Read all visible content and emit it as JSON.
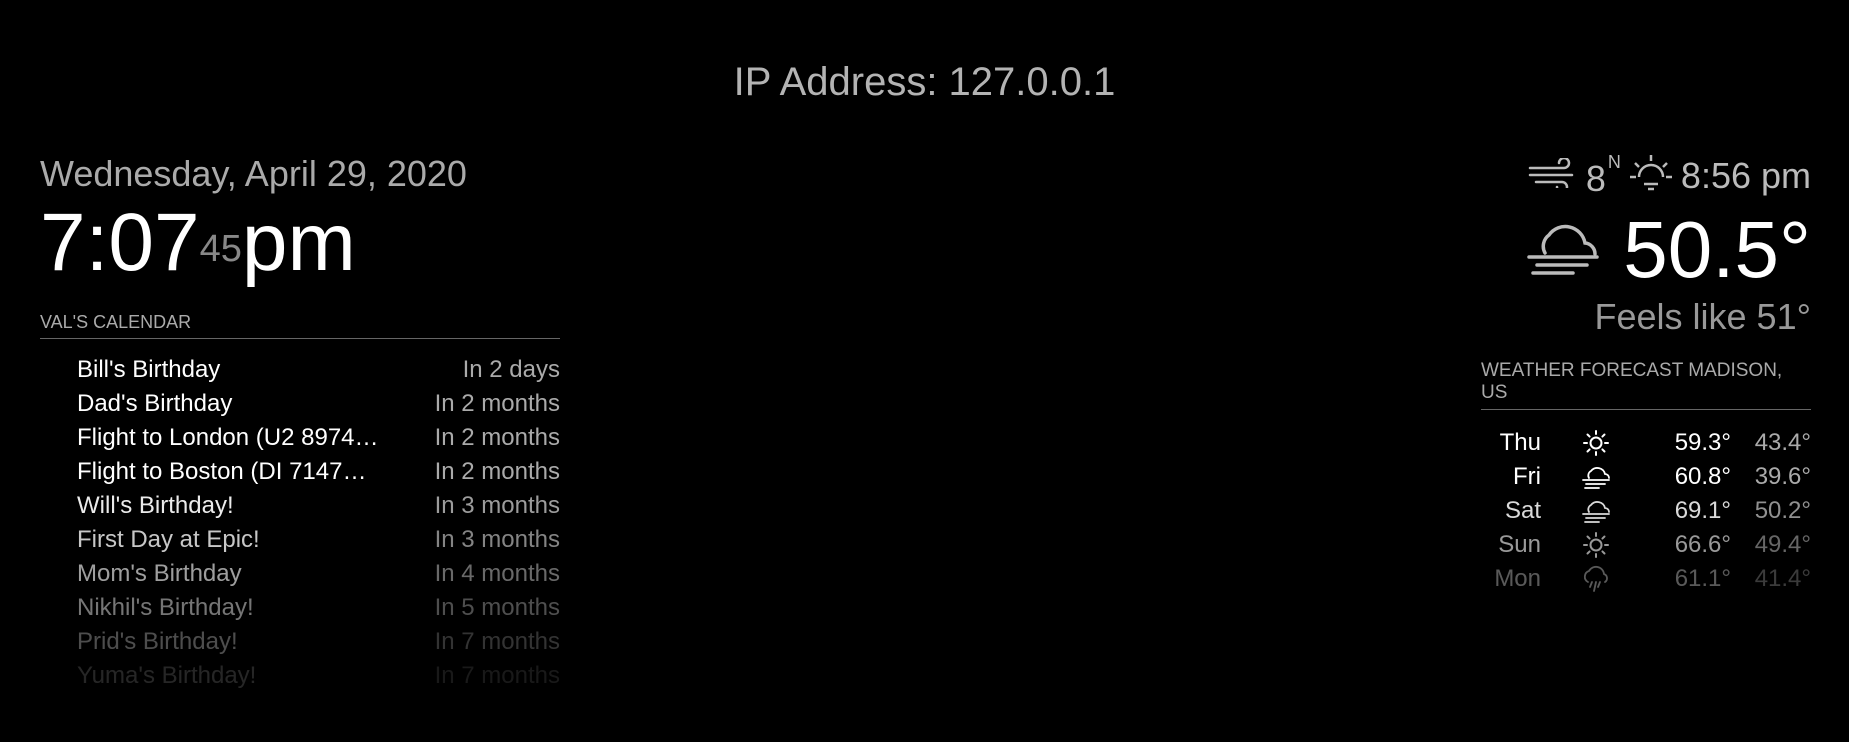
{
  "ip": {
    "label": "IP Address: 127.0.0.1"
  },
  "clock": {
    "date": "Wednesday, April 29, 2020",
    "hours_minutes": "7:07",
    "seconds": "45",
    "period": "pm"
  },
  "calendar": {
    "header": "VAL'S CALENDAR",
    "events": [
      {
        "title": "Bill's Birthday",
        "when": "In 2 days"
      },
      {
        "title": "Dad's Birthday",
        "when": "In 2 months"
      },
      {
        "title": "Flight to London (U2 8974…",
        "when": "In 2 months"
      },
      {
        "title": "Flight to Boston (DI 7147…",
        "when": "In 2 months"
      },
      {
        "title": "Will's Birthday!",
        "when": "In 3 months"
      },
      {
        "title": "First Day at Epic!",
        "when": "In 3 months"
      },
      {
        "title": "Mom's Birthday",
        "when": "In 4 months"
      },
      {
        "title": "Nikhil's Birthday!",
        "when": "In 5 months"
      },
      {
        "title": "Prid's Birthday!",
        "when": "In 7 months"
      },
      {
        "title": "Yuma's Birthday!",
        "when": "In 7 months"
      }
    ]
  },
  "current_weather": {
    "wind_speed": "8",
    "wind_direction": "N",
    "sunset_time": "8:56 pm",
    "temperature": "50.5°",
    "feels_like": "Feels like 51°",
    "icons": {
      "wind": "wind-icon",
      "sunset": "sunset-icon",
      "condition": "fog-cloud-icon"
    }
  },
  "forecast": {
    "header": "WEATHER FORECAST MADISON, US",
    "days": [
      {
        "day": "Thu",
        "icon": "sun-icon",
        "max": "59.3°",
        "min": "43.4°"
      },
      {
        "day": "Fri",
        "icon": "fog-cloud-icon",
        "max": "60.8°",
        "min": "39.6°"
      },
      {
        "day": "Sat",
        "icon": "fog-cloud-icon",
        "max": "69.1°",
        "min": "50.2°"
      },
      {
        "day": "Sun",
        "icon": "sun-icon",
        "max": "66.6°",
        "min": "49.4°"
      },
      {
        "day": "Mon",
        "icon": "rain-icon",
        "max": "61.1°",
        "min": "41.4°"
      }
    ]
  }
}
